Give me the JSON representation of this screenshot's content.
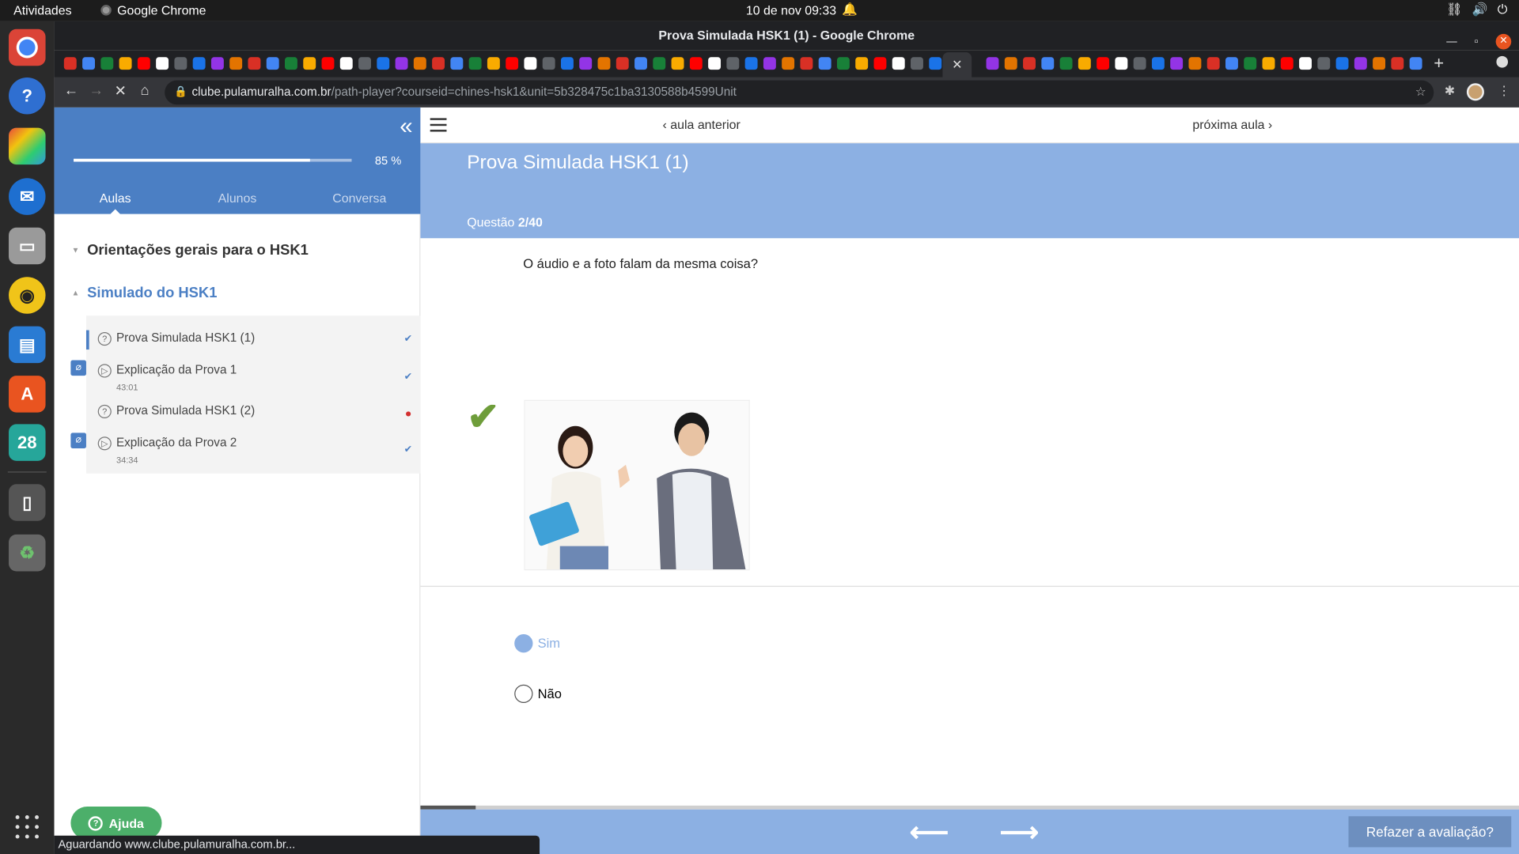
{
  "system": {
    "activities": "Atividades",
    "app_name": "Google Chrome",
    "clock": "10 de nov  09:33"
  },
  "dock": {
    "calendar_day": "28"
  },
  "browser": {
    "window_title": "Prova Simulada HSK1 (1) - Google Chrome",
    "url_host": "clube.pulamuralha.com.br",
    "url_path": "/path-player?courseid=chines-hsk1&unit=5b328475c1ba3130588b4599Unit",
    "status_text": "Aguardando www.clube.pulamuralha.com.br..."
  },
  "sidebar": {
    "progress_percent": 85,
    "progress_label": "85 %",
    "tabs": [
      "Aulas",
      "Alunos",
      "Conversa"
    ],
    "modules": [
      {
        "title": "Orientações gerais para o HSK1"
      },
      {
        "title": "Simulado do HSK1"
      }
    ],
    "lessons": [
      {
        "title": "Prova Simulada HSK1 (1)",
        "duration": ""
      },
      {
        "title": "Explicação da Prova 1",
        "duration": "43:01"
      },
      {
        "title": "Prova Simulada HSK1 (2)",
        "duration": ""
      },
      {
        "title": "Explicação da Prova 2",
        "duration": "34:34"
      }
    ],
    "help_label": "Ajuda"
  },
  "lesson_nav": {
    "prev": "aula anterior",
    "next": "próxima aula"
  },
  "quiz": {
    "title": "Prova Simulada HSK1 (1)",
    "question_prefix": "Questão",
    "question_number": "2/40",
    "question_text": "O áudio e a foto falam da mesma coisa?",
    "options": [
      {
        "label": "Sim",
        "selected": true
      },
      {
        "label": "Não",
        "selected": false
      }
    ],
    "bottom_progress": 0.05,
    "retry_label": "Refazer a avaliação?"
  },
  "colors": {
    "primary": "#4b7fc4",
    "hero": "#8cb0e3",
    "success": "#6e9d3a"
  }
}
